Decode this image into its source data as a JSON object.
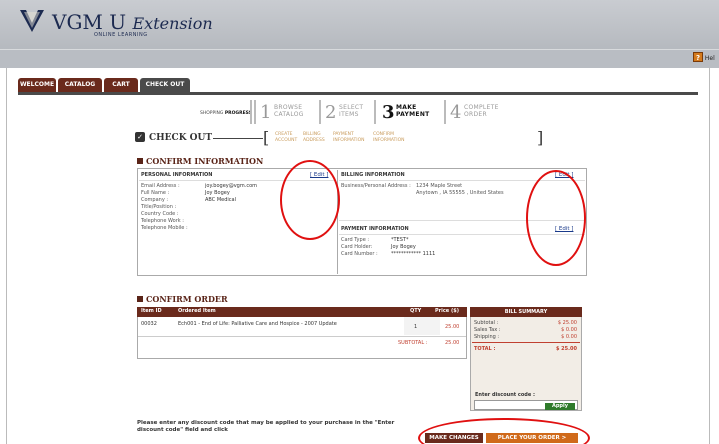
{
  "header": {
    "logo_title": "VGM U",
    "logo_title_ext": "Extension",
    "logo_sub": "ONLINE LEARNING",
    "help": "Hel"
  },
  "tabs": [
    {
      "label": "WELCOME"
    },
    {
      "label": "CATALOG"
    },
    {
      "label": "CART"
    },
    {
      "label": "CHECK OUT"
    }
  ],
  "progress": {
    "label_prefix": "SHOPPING",
    "label_bold": "PROGRESS",
    "steps": [
      {
        "num": "1",
        "line1": "BROWSE",
        "line2": "CATALOG"
      },
      {
        "num": "2",
        "line1": "SELECT",
        "line2": "ITEMS"
      },
      {
        "num": "3",
        "line1": "MAKE",
        "line2": "PAYMENT"
      },
      {
        "num": "4",
        "line1": "COMPLETE",
        "line2": "ORDER"
      }
    ]
  },
  "checkout": {
    "title": "CHECK OUT",
    "steps": [
      {
        "line1": "CREATE",
        "line2": "ACCOUNT"
      },
      {
        "line1": "BILLING",
        "line2": "ADDRESS"
      },
      {
        "line1": "PAYMENT",
        "line2": "INFORMATION"
      },
      {
        "line1": "CONFIRM",
        "line2": "INFORMATION"
      }
    ]
  },
  "confirm_info": {
    "title": "CONFIRM INFORMATION",
    "personal": {
      "heading": "PERSONAL INFORMATION",
      "edit": "[ Edit ]",
      "fields": [
        {
          "label": "Email Address :",
          "value": "joy.bogey@vgm.com"
        },
        {
          "label": "Full Name :",
          "value": "Joy  Bogey"
        },
        {
          "label": "Company :",
          "value": "ABC Medical"
        },
        {
          "label": "Title/Position :",
          "value": ""
        },
        {
          "label": "Country Code :",
          "value": ""
        },
        {
          "label": "Telephone Work :",
          "value": ""
        },
        {
          "label": "Telephone Mobile :",
          "value": ""
        }
      ]
    },
    "billing": {
      "heading": "BILLING INFORMATION",
      "edit": "[ Edit ]",
      "label": "Business/Personal Address :",
      "line1": "1234 Maple Street",
      "line2": "Anytown , IA  55555 , United States"
    },
    "payment": {
      "heading": "PAYMENT INFORMATION",
      "edit": "[ Edit ]",
      "fields": [
        {
          "label": "Card Type :",
          "value": "*TEST*"
        },
        {
          "label": "Card Holder:",
          "value": "Joy Bogey"
        },
        {
          "label": "Card Number :",
          "value": "************ 1111"
        }
      ]
    }
  },
  "confirm_order": {
    "title": "CONFIRM ORDER",
    "columns": [
      "Item ID",
      "Ordered Item",
      "QTY",
      "Price ($)"
    ],
    "rows": [
      {
        "id": "00032",
        "item": "Ech001 - End of Life: Palliative Care and Hospice - 2007 Update",
        "qty": "1",
        "price": "25.00"
      }
    ],
    "subtotal_label": "SUBTOTAL :",
    "subtotal_value": "25.00"
  },
  "bill_summary": {
    "heading": "BILL SUMMARY",
    "subtotal_label": "Subtotal :",
    "subtotal": "$ 25.00",
    "tax_label": "Sales Tax :",
    "tax": "$ 0.00",
    "shipping_label": "Shipping :",
    "shipping": "$ 0.00",
    "total_label": "TOTAL :",
    "total": "$ 25.00",
    "discount_label": "Enter discount code :",
    "apply": "Apply"
  },
  "note": "Please enter any discount code that may be applied to your purchase in the \"Enter discount code\" field and click",
  "actions": {
    "make_changes": "MAKE CHANGES",
    "place_order": "PLACE YOUR ORDER  >"
  },
  "colors": {
    "accent": "#6a2a1c",
    "highlight": "#d06a1a",
    "annotation": "#e01010"
  }
}
